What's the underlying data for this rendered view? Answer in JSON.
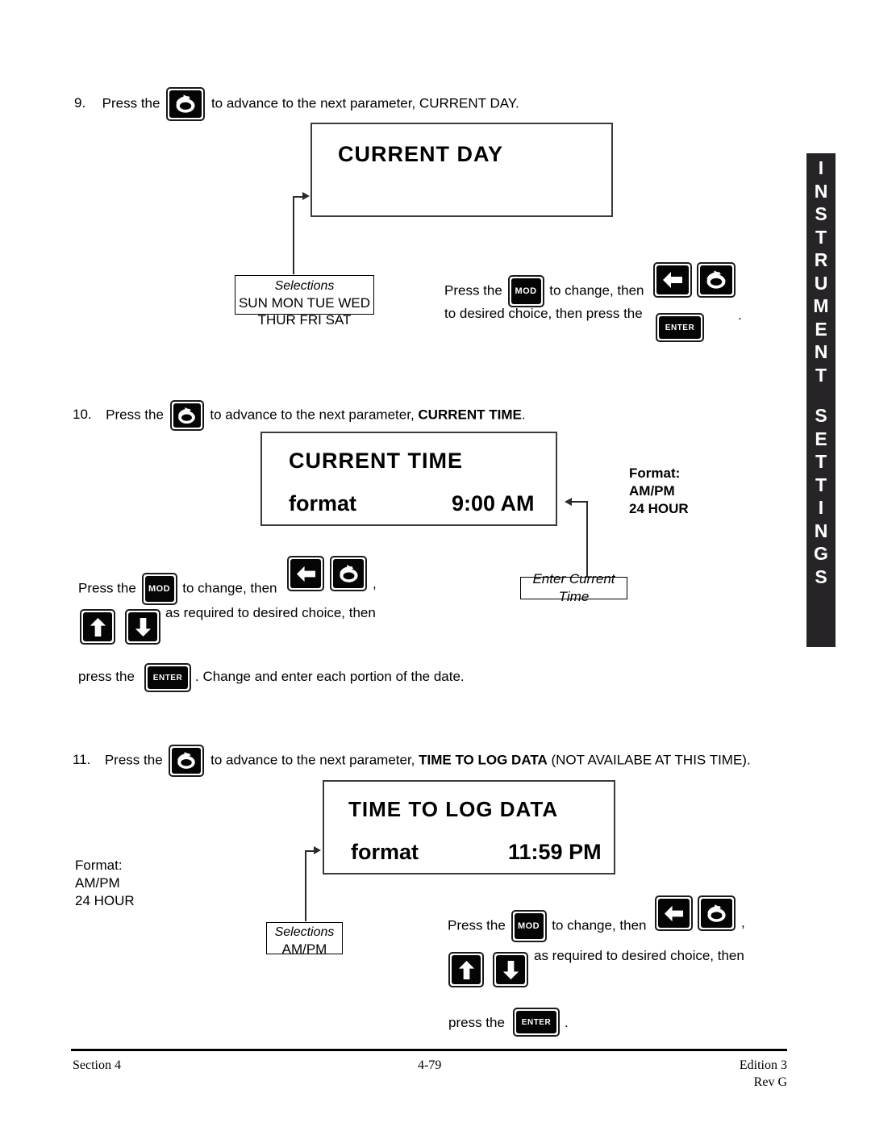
{
  "side_tab": {
    "line1": "INSTRUMENT",
    "line2": "SETTINGS"
  },
  "steps": [
    {
      "number": "9.",
      "text_before": "Press the",
      "text_after": "to advance to the next parameter, CURRENT DAY.",
      "key_icon": "rotate-advance-icon"
    },
    {
      "number": "10.",
      "text_before": "Press the",
      "text_after_plain": "to advance to the next parameter,",
      "text_after_bold": "CURRENT TIME",
      "text_tail": ".",
      "key_icon": "rotate-advance-icon"
    },
    {
      "number": "11.",
      "text_before": "Press  the",
      "text_after_plain": "to advance to the next parameter,",
      "text_after_bold": "TIME TO LOG DATA",
      "text_tail": "(NOT AVAILABE AT THIS TIME).",
      "key_icon": "rotate-advance-icon"
    }
  ],
  "displays": [
    {
      "title": "CURRENT  DAY",
      "label": "",
      "value": ""
    },
    {
      "title": "CURRENT  TIME",
      "label": "format",
      "value": "9:00  AM"
    },
    {
      "title": "TIME  TO  LOG  DATA",
      "label": "format",
      "value": "11:59  PM"
    }
  ],
  "day_selections": {
    "heading": "Selections",
    "line1": "SUN  MON  TUE  WED",
    "line2": "THUR  FRI  SAT"
  },
  "day_instructions": {
    "part1": "Press the",
    "part2": "to change, then",
    "part3": "to desired choice, then press the",
    "part4": "."
  },
  "time_format_note": {
    "heading": "Format:",
    "line1": "AM/PM",
    "line2": "24 HOUR"
  },
  "enter_current_time_callout": "Enter Current Time",
  "time_instructions": {
    "part1": "Press the",
    "part2": "to change, then",
    "part3": ",",
    "part4": "as required to desired choice, then",
    "part5": "press  the",
    "part6": ".   Change and enter each portion of the date."
  },
  "log_format_note": {
    "heading": "Format:",
    "line1": "AM/PM",
    "line2": "24 HOUR"
  },
  "log_selections": {
    "heading": "Selections",
    "line1": "AM/PM"
  },
  "log_instructions": {
    "part1": "Press the",
    "part2": "to change, then",
    "part3": ",",
    "part4": "as required to desired choice, then",
    "part5": "press  the",
    "part6": "."
  },
  "keys": {
    "mod_label": "MOD",
    "enter_label": "ENTER",
    "rotate_icon": "rotate-advance-icon",
    "left_icon": "arrow-left-icon",
    "up_icon": "arrow-up-icon",
    "down_icon": "arrow-down-icon"
  },
  "footer": {
    "left": "Section 4",
    "center": "4-79",
    "right_line1": "Edition 3",
    "right_line2": "Rev G"
  },
  "colors": {
    "tab_background": "#262426",
    "key_face": "#050505",
    "line": "#2b2b2b",
    "display_border": "#3b3b3b"
  }
}
